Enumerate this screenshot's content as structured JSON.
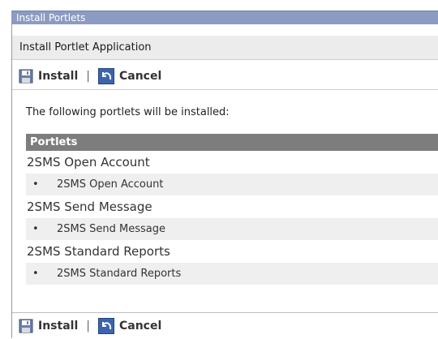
{
  "window": {
    "title": "Install Portlets"
  },
  "panel": {
    "title": "Install Portlet Application"
  },
  "toolbar": {
    "install_label": "Install",
    "separator": "|",
    "cancel_label": "Cancel"
  },
  "intro": "The following portlets will be installed:",
  "table": {
    "header": "Portlets",
    "groups": [
      {
        "name": "2SMS Open Account",
        "items": [
          "2SMS Open Account"
        ]
      },
      {
        "name": "2SMS Send Message",
        "items": [
          "2SMS Send Message"
        ]
      },
      {
        "name": "2SMS Standard Reports",
        "items": [
          "2SMS Standard Reports"
        ]
      }
    ]
  },
  "icons": {
    "install": "floppy-disk-icon",
    "cancel": "undo-arrow-icon"
  },
  "colors": {
    "title_bar": "#8b9bc2",
    "table_header": "#7d7d7d",
    "item_row": "#efefef"
  }
}
